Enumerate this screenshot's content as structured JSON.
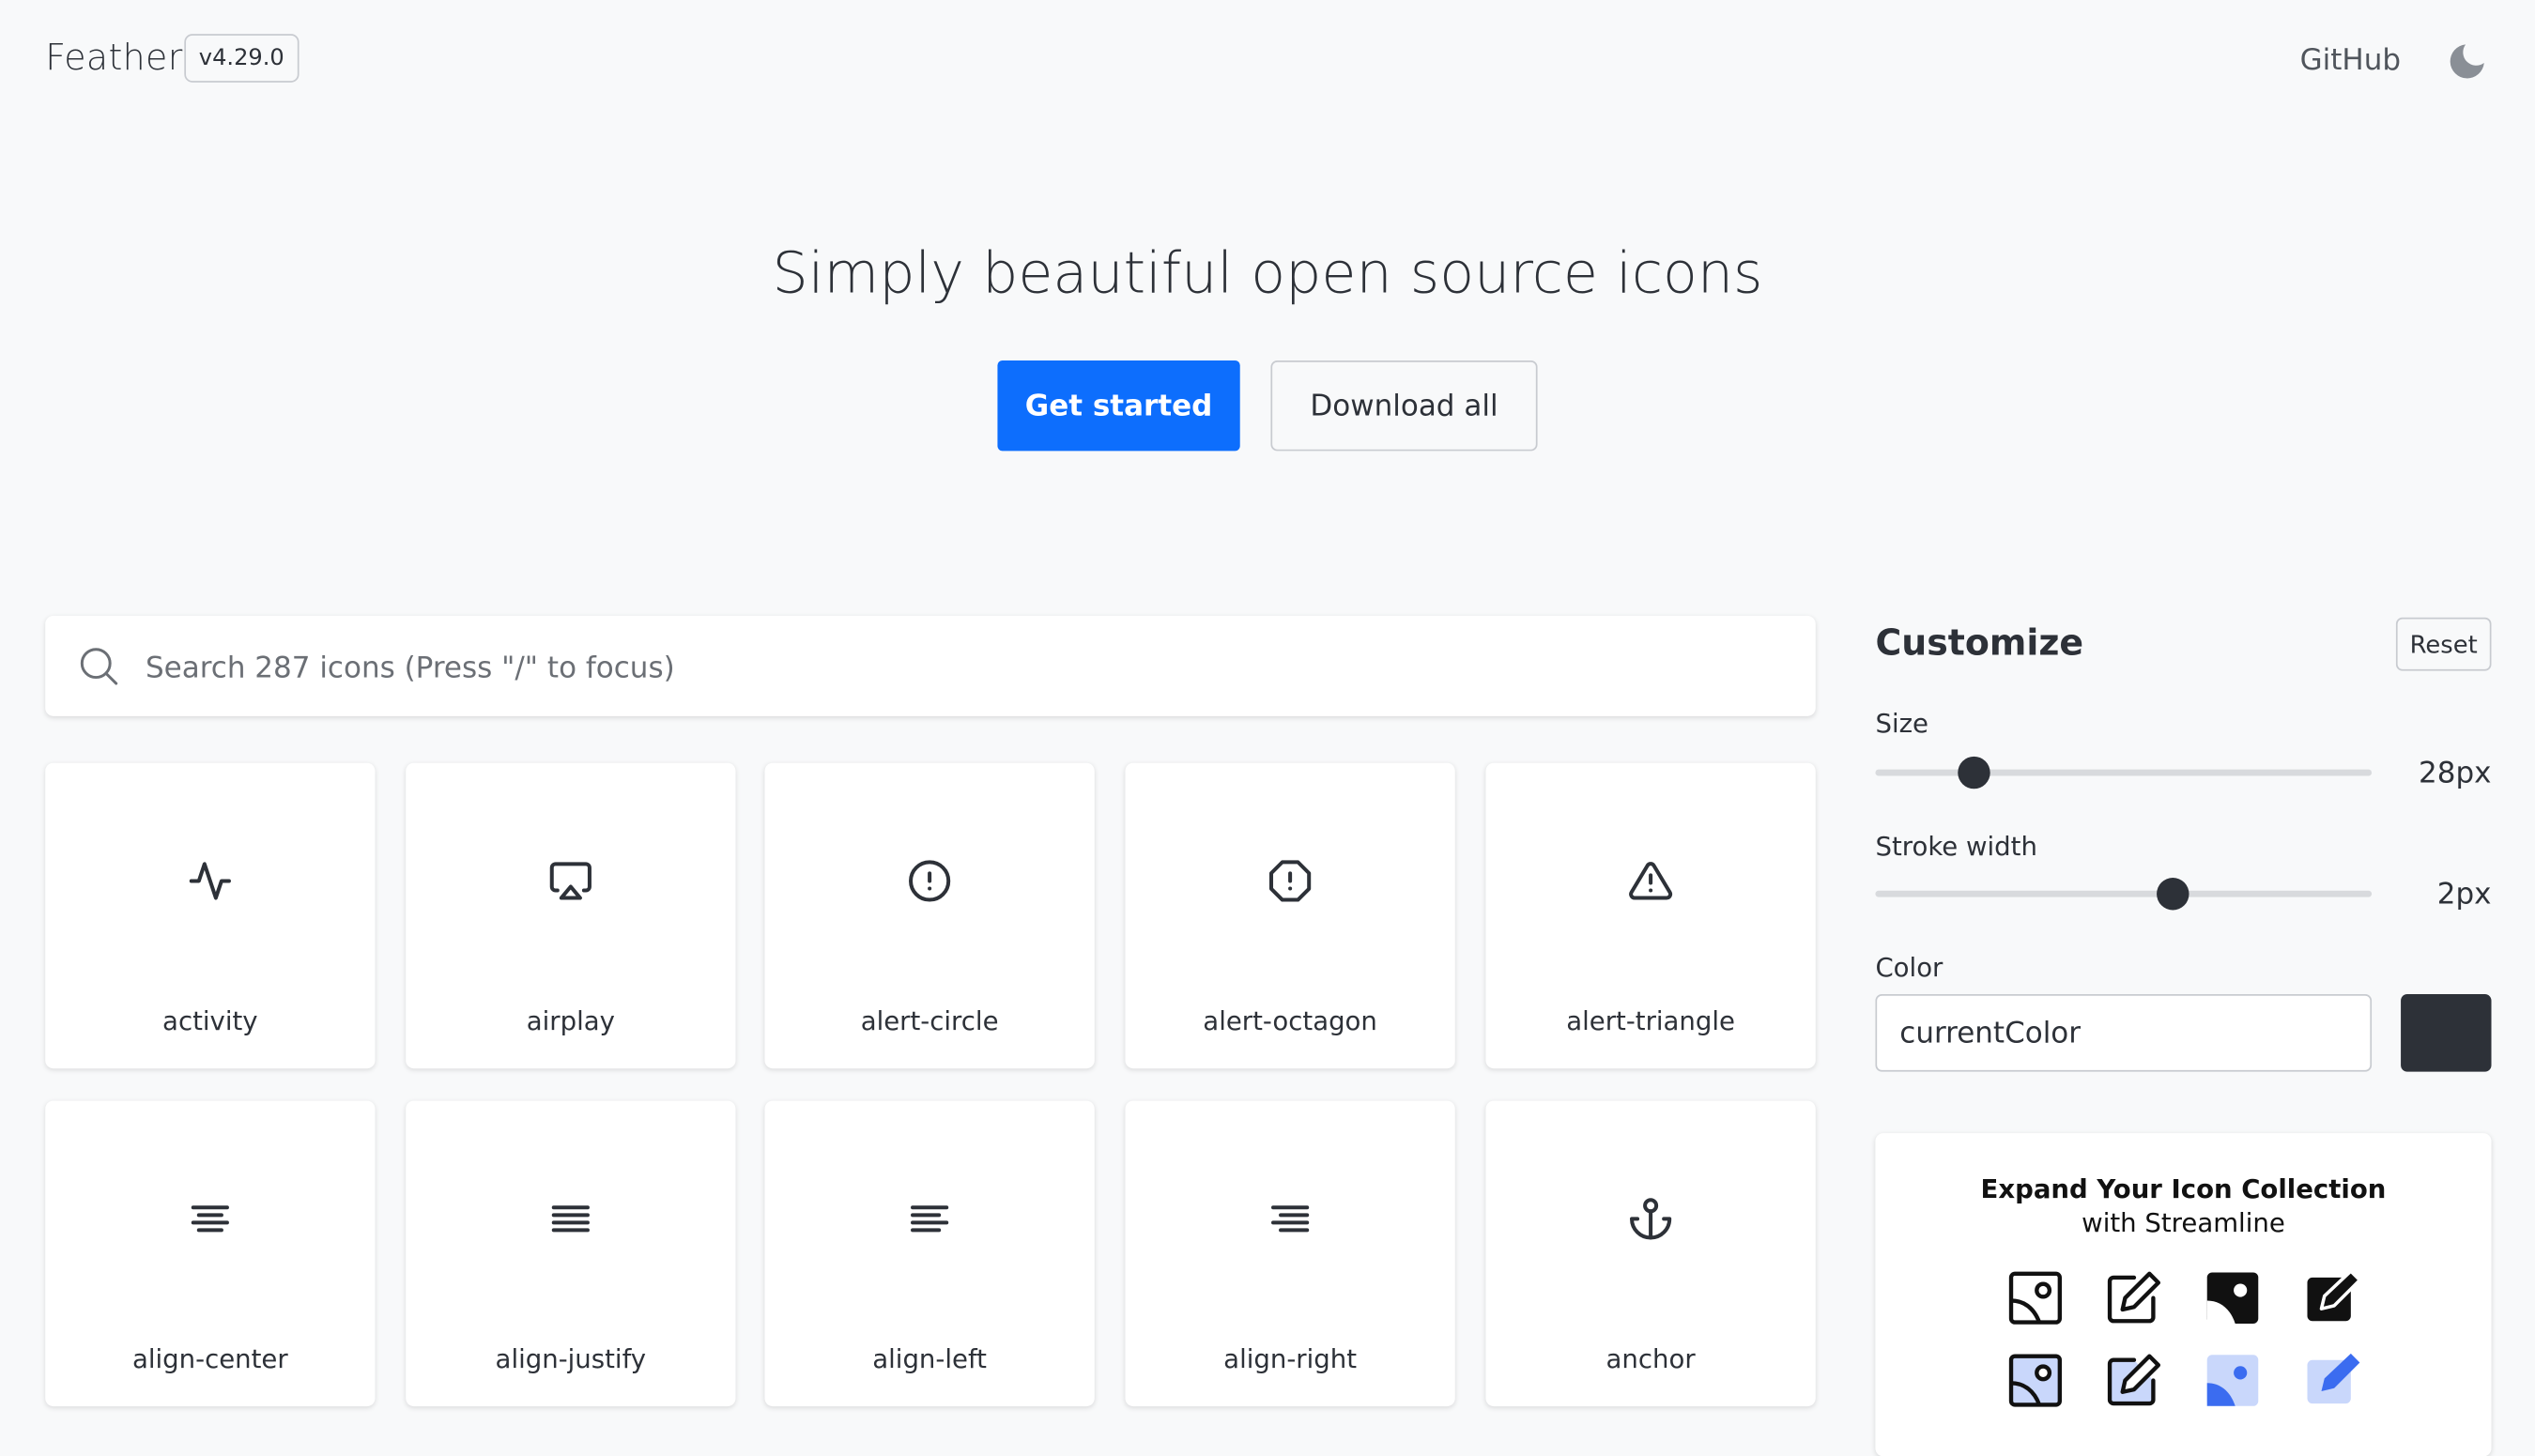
{
  "header": {
    "brand": "Feather",
    "version": "v4.29.0",
    "github_label": "GitHub",
    "theme_toggle_icon": "moon-icon"
  },
  "hero": {
    "title": "Simply beautiful open source icons",
    "primary_button": "Get started",
    "secondary_button": "Download all"
  },
  "search": {
    "placeholder": "Search 287 icons (Press \"/\" to focus)",
    "value": "",
    "icon": "search-icon"
  },
  "icons": [
    {
      "name": "activity",
      "icon": "activity-icon"
    },
    {
      "name": "airplay",
      "icon": "airplay-icon"
    },
    {
      "name": "alert-circle",
      "icon": "alert-circle-icon"
    },
    {
      "name": "alert-octagon",
      "icon": "alert-octagon-icon"
    },
    {
      "name": "alert-triangle",
      "icon": "alert-triangle-icon"
    },
    {
      "name": "align-center",
      "icon": "align-center-icon"
    },
    {
      "name": "align-justify",
      "icon": "align-justify-icon"
    },
    {
      "name": "align-left",
      "icon": "align-left-icon"
    },
    {
      "name": "align-right",
      "icon": "align-right-icon"
    },
    {
      "name": "anchor",
      "icon": "anchor-icon"
    }
  ],
  "customize": {
    "title": "Customize",
    "reset_label": "Reset",
    "size_label": "Size",
    "size_value": "28px",
    "size_fraction": 0.2,
    "stroke_label": "Stroke width",
    "stroke_value": "2px",
    "stroke_fraction": 0.6,
    "color_label": "Color",
    "color_value": "currentColor",
    "color_swatch": "#2d3138"
  },
  "ad": {
    "title": "Expand Your Icon Collection",
    "subtitle": "with Streamline",
    "accent": "#3b6cf0",
    "icons": [
      "image-outline-icon",
      "edit-outline-icon",
      "image-solid-icon",
      "edit-solid-icon",
      "image-duotone-icon",
      "edit-duotone-icon",
      "image-flat-blue-icon",
      "edit-flat-blue-icon"
    ]
  },
  "colors": {
    "background": "#f8f9fa",
    "text": "#2d3138",
    "primary": "#0d6efd"
  }
}
